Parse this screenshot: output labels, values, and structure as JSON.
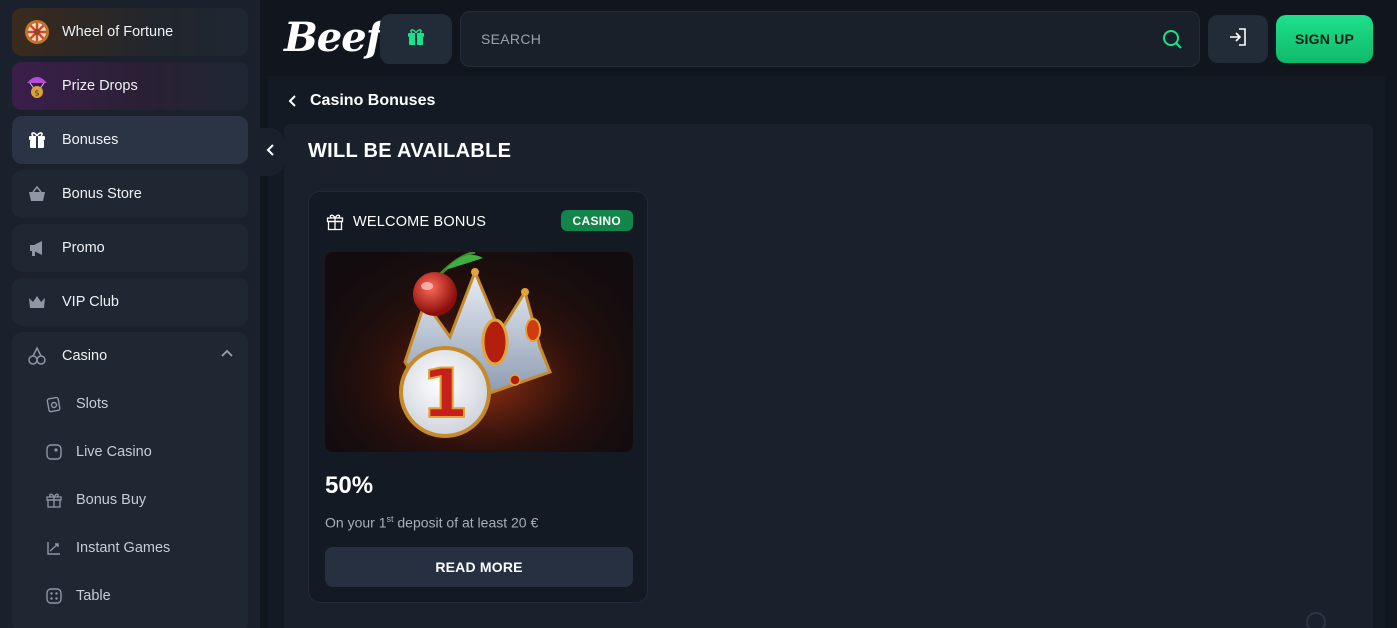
{
  "sidebar": {
    "items": [
      {
        "label": "Wheel of Fortune",
        "icon": "wheel-icon"
      },
      {
        "label": "Prize Drops",
        "icon": "prize-drop-icon"
      },
      {
        "label": "Bonuses",
        "icon": "gift-icon"
      },
      {
        "label": "Bonus Store",
        "icon": "basket-icon"
      },
      {
        "label": "Promo",
        "icon": "megaphone-icon"
      },
      {
        "label": "VIP Club",
        "icon": "crown-icon"
      }
    ],
    "casino": {
      "label": "Casino",
      "icon": "cherries-icon",
      "sub_items": [
        {
          "label": "Slots",
          "icon": "slots-icon"
        },
        {
          "label": "Live Casino",
          "icon": "live-casino-icon"
        },
        {
          "label": "Bonus Buy",
          "icon": "gift-icon"
        },
        {
          "label": "Instant Games",
          "icon": "trend-icon"
        },
        {
          "label": "Table",
          "icon": "dice-icon"
        }
      ]
    }
  },
  "header": {
    "logo_text": "Beef",
    "search_placeholder": "SEARCH",
    "signup_label": "SIGN UP"
  },
  "breadcrumb": {
    "label": "Casino Bonuses"
  },
  "main": {
    "section_title": "WILL BE AVAILABLE",
    "card": {
      "title": "WELCOME BONUS",
      "badge": "CASINO",
      "percent": "50%",
      "desc_prefix": "On your 1",
      "desc_sup": "st",
      "desc_suffix": " deposit of at least 20 €",
      "button": "READ MORE"
    }
  },
  "colors": {
    "accent_green": "#1fe08a",
    "badge_green": "#12854a",
    "background": "#141a23"
  }
}
